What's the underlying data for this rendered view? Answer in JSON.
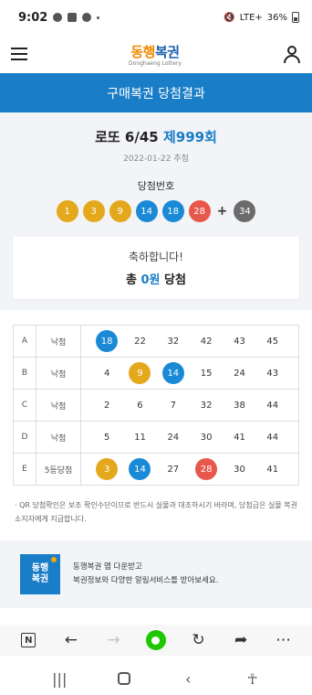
{
  "status_bar": {
    "time": "9:02",
    "network": "LTE+",
    "battery": "36%"
  },
  "header": {
    "logo_text_1": "동행",
    "logo_text_2": "복권",
    "logo_sub": "Donghaeng Lottery"
  },
  "title_bar": {
    "title": "구매복권 당첨결과"
  },
  "result": {
    "game": "로또 6/45",
    "round": "제999회",
    "draw_date": "2022-01-22 추첨",
    "winning_label": "당첨번호",
    "numbers": [
      {
        "value": "1",
        "color": "#e3a81b"
      },
      {
        "value": "3",
        "color": "#e3a81b"
      },
      {
        "value": "9",
        "color": "#e3a81b"
      },
      {
        "value": "14",
        "color": "#1a8ad6"
      },
      {
        "value": "18",
        "color": "#1a8ad6"
      },
      {
        "value": "28",
        "color": "#e7574b"
      }
    ],
    "plus": "+",
    "bonus": {
      "value": "34",
      "color": "#6b6b6b"
    },
    "congrats": "축하합니다!",
    "prize_prefix": "총 ",
    "prize_amount": "0원",
    "prize_suffix": " 당첨"
  },
  "tickets": [
    {
      "slot": "A",
      "result": "낙첨",
      "numbers": [
        {
          "value": "18",
          "hit": true,
          "color": "#1a8ad6"
        },
        {
          "value": "22",
          "hit": false
        },
        {
          "value": "32",
          "hit": false
        },
        {
          "value": "42",
          "hit": false
        },
        {
          "value": "43",
          "hit": false
        },
        {
          "value": "45",
          "hit": false
        }
      ]
    },
    {
      "slot": "B",
      "result": "낙첨",
      "numbers": [
        {
          "value": "4",
          "hit": false
        },
        {
          "value": "9",
          "hit": true,
          "color": "#e3a81b"
        },
        {
          "value": "14",
          "hit": true,
          "color": "#1a8ad6"
        },
        {
          "value": "15",
          "hit": false
        },
        {
          "value": "24",
          "hit": false
        },
        {
          "value": "43",
          "hit": false
        }
      ]
    },
    {
      "slot": "C",
      "result": "낙첨",
      "numbers": [
        {
          "value": "2",
          "hit": false
        },
        {
          "value": "6",
          "hit": false
        },
        {
          "value": "7",
          "hit": false
        },
        {
          "value": "32",
          "hit": false
        },
        {
          "value": "38",
          "hit": false
        },
        {
          "value": "44",
          "hit": false
        }
      ]
    },
    {
      "slot": "D",
      "result": "낙첨",
      "numbers": [
        {
          "value": "5",
          "hit": false
        },
        {
          "value": "11",
          "hit": false
        },
        {
          "value": "24",
          "hit": false
        },
        {
          "value": "30",
          "hit": false
        },
        {
          "value": "41",
          "hit": false
        },
        {
          "value": "44",
          "hit": false
        }
      ]
    },
    {
      "slot": "E",
      "result": "5등당첨",
      "numbers": [
        {
          "value": "3",
          "hit": true,
          "color": "#e3a81b"
        },
        {
          "value": "14",
          "hit": true,
          "color": "#1a8ad6"
        },
        {
          "value": "27",
          "hit": false
        },
        {
          "value": "28",
          "hit": true,
          "color": "#e7574b"
        },
        {
          "value": "30",
          "hit": false
        },
        {
          "value": "41",
          "hit": false
        }
      ]
    }
  ],
  "notice": "· QR 당첨확인은 보조 확인수단이므로 반드시 실물과 대조하시기 바라며, 당첨금은 실물 복권소지자에게 지급합니다.",
  "app_banner": {
    "icon_line_1": "동행",
    "icon_line_2": "복권",
    "line_1": "동행복권 앱 다운받고",
    "line_2": "복권정보와 다양한 알림서비스를 받아보세요."
  },
  "browser_bar": {
    "icons": [
      "naver-n-icon",
      "back-arrow-icon",
      "forward-arrow-icon",
      "home-green-icon",
      "reload-icon",
      "share-icon",
      "more-icon"
    ]
  },
  "system_nav": {
    "icons": [
      "recent-apps-icon",
      "home-icon",
      "back-icon",
      "accessibility-icon"
    ]
  }
}
